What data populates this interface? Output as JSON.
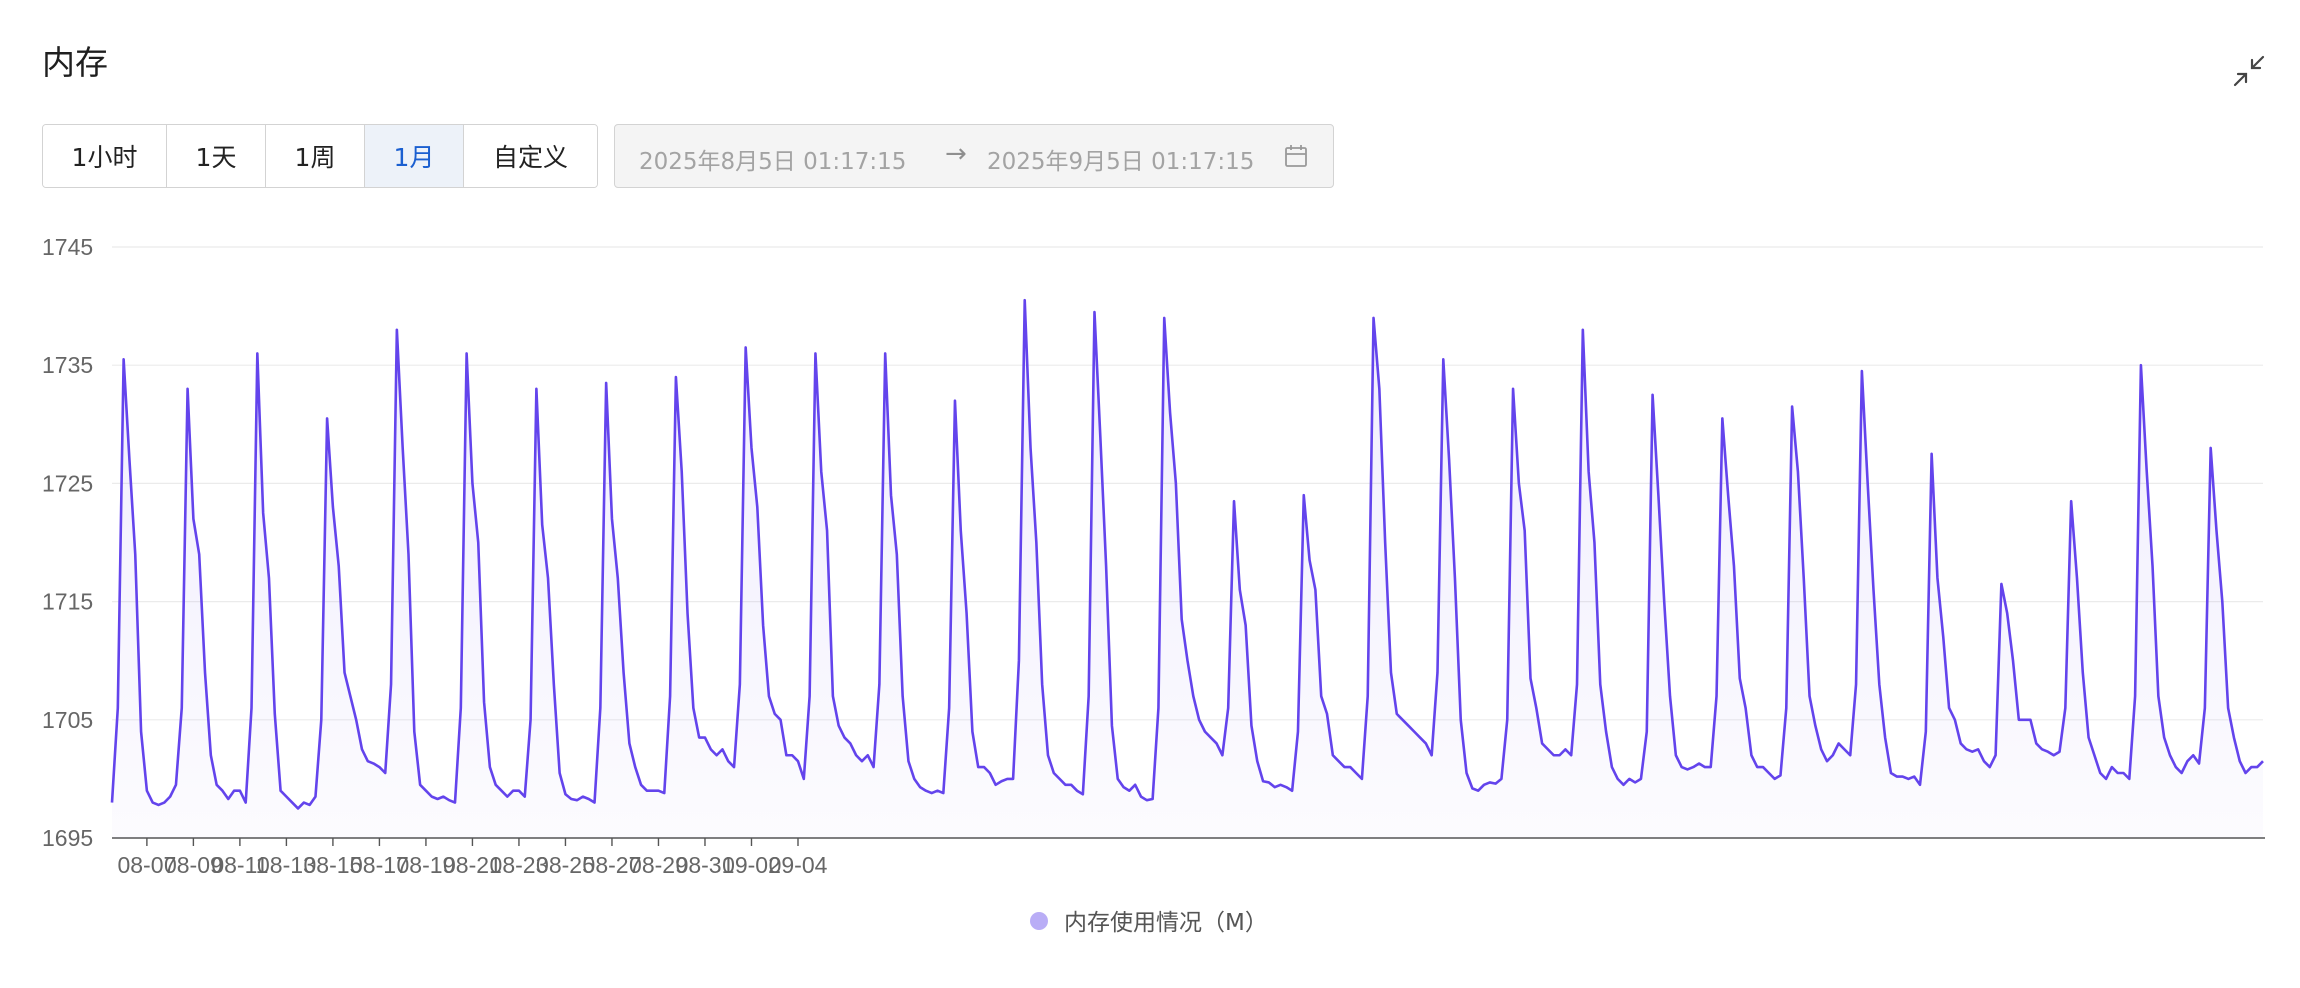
{
  "panel": {
    "title": "内存"
  },
  "range_buttons": [
    {
      "label": "1小时",
      "active": false
    },
    {
      "label": "1天",
      "active": false
    },
    {
      "label": "1周",
      "active": false
    },
    {
      "label": "1月",
      "active": true
    },
    {
      "label": "自定义",
      "active": false
    }
  ],
  "date_range": {
    "start": "2025年8月5日 01:17:15",
    "separator": "→",
    "end": "2025年9月5日 01:17:15"
  },
  "icons": {
    "collapse": "collapse-icon",
    "calendar": "calendar-icon"
  },
  "colors": {
    "series": "#6344ec",
    "active_button_text": "#1a5fd0",
    "active_button_bg": "#edf2f9"
  },
  "chart_data": {
    "type": "area",
    "x_start": "08-05 12:00",
    "x_step_hours": 6,
    "x_ticks": [
      "08-07",
      "08-09",
      "08-11",
      "08-13",
      "08-15",
      "08-17",
      "08-19",
      "08-21",
      "08-23",
      "08-25",
      "08-27",
      "08-29",
      "08-31",
      "09-02",
      "09-04"
    ],
    "y_ticks": [
      1745,
      1735,
      1725,
      1715,
      1705,
      1695
    ],
    "ylim": [
      1695,
      1745
    ],
    "grid": true,
    "legend_position": "bottom-center",
    "series": [
      {
        "name": "内存使用情况（M）",
        "values": [
          1698,
          1706,
          1735.5,
          1727,
          1719,
          1704,
          1699,
          1698,
          1697.8,
          1698,
          1698.5,
          1699.5,
          1706,
          1733,
          1722,
          1719,
          1709,
          1702,
          1699.5,
          1699,
          1698.3,
          1699,
          1699,
          1698,
          1706,
          1736,
          1722.5,
          1717,
          1705.5,
          1699,
          1698.5,
          1698,
          1697.5,
          1698,
          1697.8,
          1698.5,
          1705,
          1730.5,
          1723,
          1718,
          1709,
          1707,
          1705,
          1702.5,
          1701.5,
          1701.3,
          1701,
          1700.5,
          1708,
          1738,
          1728,
          1719,
          1704,
          1699.5,
          1699,
          1698.5,
          1698.3,
          1698.5,
          1698.2,
          1698,
          1706,
          1736,
          1725,
          1720,
          1706.5,
          1701,
          1699.5,
          1699,
          1698.5,
          1699,
          1699,
          1698.5,
          1705,
          1733,
          1721.5,
          1717,
          1708,
          1700.5,
          1698.7,
          1698.3,
          1698.2,
          1698.5,
          1698.3,
          1698,
          1706,
          1733.5,
          1722,
          1717,
          1709,
          1703,
          1701,
          1699.5,
          1699,
          1699,
          1699,
          1698.8,
          1707,
          1734,
          1726,
          1714,
          1706,
          1703.5,
          1703.5,
          1702.5,
          1702,
          1702.5,
          1701.5,
          1701,
          1708,
          1736.5,
          1728,
          1723,
          1713,
          1707,
          1705.5,
          1705,
          1702,
          1702,
          1701.5,
          1700,
          1707,
          1736,
          1726,
          1721,
          1707,
          1704.5,
          1703.5,
          1703,
          1702,
          1701.5,
          1702,
          1701,
          1708,
          1736,
          1724,
          1719,
          1707,
          1701.5,
          1700,
          1699.3,
          1699,
          1698.8,
          1699,
          1698.8,
          1706,
          1732,
          1721,
          1714,
          1704,
          1701,
          1701,
          1700.5,
          1699.5,
          1699.8,
          1700,
          1700,
          1710,
          1740.5,
          1728,
          1720,
          1708,
          1702,
          1700.5,
          1700,
          1699.5,
          1699.5,
          1699,
          1698.7,
          1707,
          1739.5,
          1729,
          1718,
          1704.5,
          1700,
          1699.3,
          1699,
          1699.5,
          1698.5,
          1698.2,
          1698.3,
          1706,
          1739,
          1731,
          1725,
          1713.5,
          1710,
          1707,
          1705,
          1704,
          1703.5,
          1703,
          1702,
          1706,
          1723.5,
          1716,
          1713,
          1704.5,
          1701.5,
          1699.8,
          1699.7,
          1699.3,
          1699.5,
          1699.3,
          1699,
          1704,
          1724,
          1718.5,
          1716,
          1707,
          1705.5,
          1702,
          1701.5,
          1701,
          1701,
          1700.5,
          1700,
          1707,
          1739,
          1733,
          1720,
          1709,
          1705.5,
          1705,
          1704.5,
          1704,
          1703.5,
          1703,
          1702,
          1709,
          1735.5,
          1727,
          1717,
          1705,
          1700.5,
          1699.2,
          1699,
          1699.5,
          1699.7,
          1699.6,
          1700,
          1705,
          1733,
          1725,
          1721,
          1708.5,
          1706,
          1703,
          1702.5,
          1702,
          1702,
          1702.5,
          1702,
          1708,
          1738,
          1726,
          1720,
          1708,
          1704,
          1701,
          1700,
          1699.5,
          1700,
          1699.7,
          1700,
          1704,
          1732.5,
          1724,
          1715,
          1707,
          1702,
          1701,
          1700.8,
          1701,
          1701.3,
          1701,
          1701,
          1707,
          1730.5,
          1724,
          1718,
          1708.5,
          1706,
          1702,
          1701,
          1701,
          1700.5,
          1700,
          1700.3,
          1706,
          1731.5,
          1726,
          1717,
          1707,
          1704.5,
          1702.5,
          1701.5,
          1702,
          1703,
          1702.5,
          1702,
          1708,
          1734.5,
          1725,
          1716,
          1708,
          1703.5,
          1700.5,
          1700.2,
          1700.2,
          1700,
          1700.2,
          1699.5,
          1704,
          1727.5,
          1717,
          1712,
          1706,
          1705,
          1703,
          1702.5,
          1702.3,
          1702.5,
          1701.5,
          1701,
          1702,
          1716.5,
          1714,
          1710,
          1705,
          1705,
          1705,
          1703,
          1702.5,
          1702.3,
          1702,
          1702.3,
          1706,
          1723.5,
          1717,
          1709,
          1703.5,
          1702,
          1700.5,
          1700,
          1701,
          1700.5,
          1700.5,
          1700,
          1707,
          1735,
          1726,
          1718,
          1707,
          1703.5,
          1702,
          1701,
          1700.5,
          1701.5,
          1702,
          1701.3,
          1706,
          1728,
          1721,
          1715,
          1706,
          1703.5,
          1701.5,
          1700.5,
          1701,
          1701,
          1701.5
        ]
      }
    ]
  }
}
